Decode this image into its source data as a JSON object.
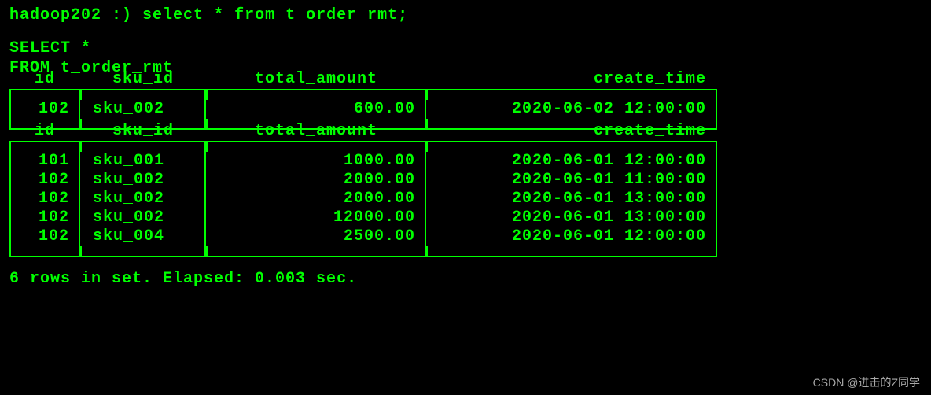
{
  "prompt": {
    "host": "hadoop202 :)",
    "command": "select * from t_order_rmt;"
  },
  "echo": {
    "line1": "SELECT *",
    "line2_kw": "FROM",
    "line2_tbl": " t_order_rmt"
  },
  "headers": {
    "id": "id",
    "sku_id": "sku_id",
    "total_amount": "total_amount",
    "create_time": "create_time"
  },
  "resultsets": [
    {
      "rows": [
        {
          "id": "102",
          "sku_id": "sku_002",
          "total_amount": "600.00",
          "create_time": "2020-06-02 12:00:00"
        }
      ]
    },
    {
      "rows": [
        {
          "id": "101",
          "sku_id": "sku_001",
          "total_amount": "1000.00",
          "create_time": "2020-06-01 12:00:00"
        },
        {
          "id": "102",
          "sku_id": "sku_002",
          "total_amount": "2000.00",
          "create_time": "2020-06-01 11:00:00"
        },
        {
          "id": "102",
          "sku_id": "sku_002",
          "total_amount": "2000.00",
          "create_time": "2020-06-01 13:00:00"
        },
        {
          "id": "102",
          "sku_id": "sku_002",
          "total_amount": "12000.00",
          "create_time": "2020-06-01 13:00:00"
        },
        {
          "id": "102",
          "sku_id": "sku_004",
          "total_amount": "2500.00",
          "create_time": "2020-06-01 12:00:00"
        }
      ]
    }
  ],
  "status": "6 rows in set. Elapsed: 0.003 sec.",
  "watermark": "CSDN @进击的Z同学",
  "chart_data": {
    "type": "table",
    "title": "t_order_rmt",
    "columns": [
      "id",
      "sku_id",
      "total_amount",
      "create_time"
    ],
    "rows_block1": [
      [
        102,
        "sku_002",
        600.0,
        "2020-06-02 12:00:00"
      ]
    ],
    "rows_block2": [
      [
        101,
        "sku_001",
        1000.0,
        "2020-06-01 12:00:00"
      ],
      [
        102,
        "sku_002",
        2000.0,
        "2020-06-01 11:00:00"
      ],
      [
        102,
        "sku_002",
        2000.0,
        "2020-06-01 13:00:00"
      ],
      [
        102,
        "sku_002",
        12000.0,
        "2020-06-01 13:00:00"
      ],
      [
        102,
        "sku_004",
        2500.0,
        "2020-06-01 12:00:00"
      ]
    ],
    "row_count": 6,
    "elapsed_sec": 0.003
  }
}
